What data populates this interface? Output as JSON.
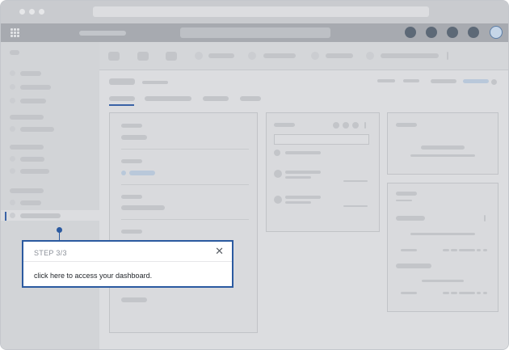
{
  "tooltip": {
    "step": "STEP 3/3",
    "message": "click here to access your dashboard."
  },
  "icons": {
    "close": "close-icon",
    "apps": "grid-icon"
  },
  "colors": {
    "accent": "#2b5aa0",
    "overlay": "#d9dadd",
    "tooltip_bg": "#ffffff"
  }
}
